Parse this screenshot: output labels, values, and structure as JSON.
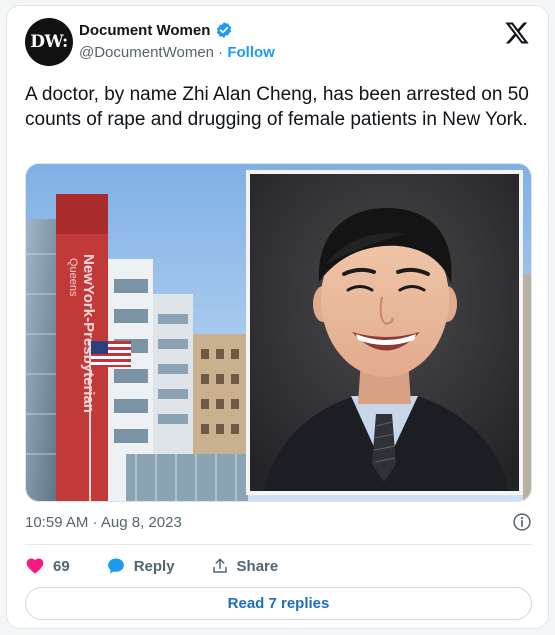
{
  "author": {
    "avatar_text": "DW:",
    "display_name": "Document Women",
    "handle": "@DocumentWomen",
    "separator": "·",
    "follow_label": "Follow"
  },
  "tweet": {
    "text": "A doctor, by name Zhi Alan Cheng, has been arrested on 50 counts of rape and drugging of female patients in New York.",
    "building_sign": "NewYork-Presbyterian",
    "building_sign_sub": "Queens",
    "timestamp": "10:59 AM · Aug 8, 2023"
  },
  "actions": {
    "likes_count": "69",
    "reply_label": "Reply",
    "share_label": "Share"
  },
  "replies_button": "Read 7 replies",
  "colors": {
    "like": "#f91880",
    "accent": "#1d9bf0",
    "verified": "#1d9bf0",
    "muted": "#536471"
  },
  "icons": {
    "brand": "x-logo-icon",
    "verified": "verified-badge-icon",
    "like": "heart-icon",
    "reply": "comment-bubble-icon",
    "share": "share-upload-icon",
    "info": "info-icon"
  }
}
